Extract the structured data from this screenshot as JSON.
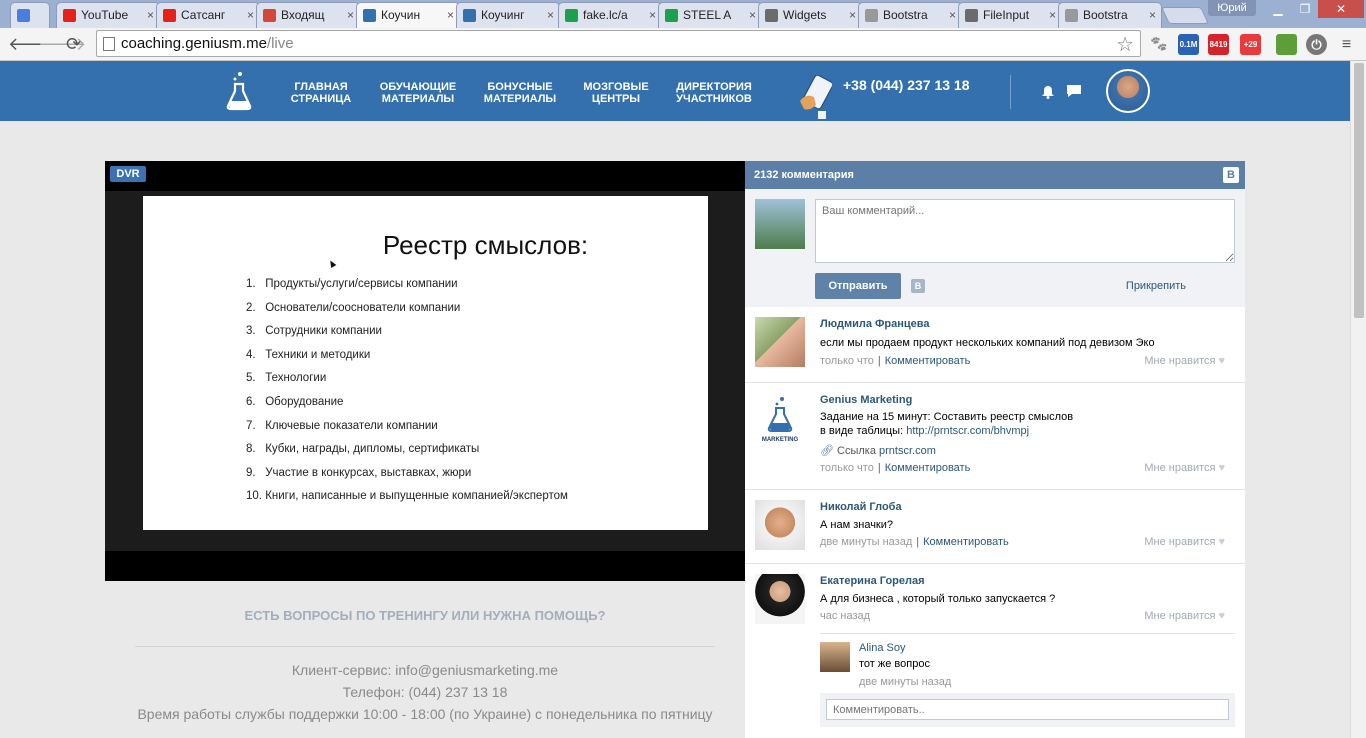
{
  "browser": {
    "tabs": [
      {
        "label": "",
        "icon": "google-icon",
        "color": "#4a7de0"
      },
      {
        "label": "YouTube",
        "icon": "youtube-icon",
        "color": "#e62117"
      },
      {
        "label": "Сатсанг",
        "icon": "youtube-icon",
        "color": "#e62117"
      },
      {
        "label": "Входящ",
        "icon": "gmail-icon",
        "color": "#d44638"
      },
      {
        "label": "Коучин",
        "icon": "flask-icon",
        "color": "#3470ad"
      },
      {
        "label": "Коучинг",
        "icon": "flask-icon",
        "color": "#3470ad"
      },
      {
        "label": "fake.lc/a",
        "icon": "windows-icon",
        "color": "#1ca04b"
      },
      {
        "label": "STEEL A",
        "icon": "windows-icon",
        "color": "#1ca04b"
      },
      {
        "label": "Widgets",
        "icon": "k-icon",
        "color": "#6b6b6b"
      },
      {
        "label": "Bootstra",
        "icon": "document-icon",
        "color": "#999999"
      },
      {
        "label": "FileInput",
        "icon": "k-icon",
        "color": "#6b6b6b"
      },
      {
        "label": "Bootstra",
        "icon": "document-icon",
        "color": "#999999"
      }
    ],
    "user_name": "Юрий",
    "url_host": "coaching.geniusm.me",
    "url_path": "/live",
    "extensions": [
      {
        "name": "paw-icon",
        "label": "",
        "color": "#8e8e8e"
      },
      {
        "name": "counter-icon",
        "label": "0.1M",
        "color": "#2a62b5"
      },
      {
        "name": "mail-counter-icon",
        "label": "8419",
        "color": "#d4232b"
      },
      {
        "name": "weather-icon",
        "label": "+29",
        "color": "#e83a3a"
      },
      {
        "name": "eyedropper-icon",
        "label": "",
        "color": "#5d9e3a"
      },
      {
        "name": "power-icon",
        "label": "",
        "color": "#777777"
      },
      {
        "name": "menu-icon",
        "label": "",
        "color": "#555555"
      }
    ]
  },
  "site": {
    "nav": [
      {
        "line1": "Главная",
        "line2": "страница"
      },
      {
        "line1": "Обучающие",
        "line2": "материалы"
      },
      {
        "line1": "Бонусные",
        "line2": "материалы"
      },
      {
        "line1": "Мозговые",
        "line2": "центры"
      },
      {
        "line1": "Директория",
        "line2": "участников"
      }
    ],
    "phone": "+38 (044) 237 13 18"
  },
  "video": {
    "badge": "DVR",
    "slide_title": "Реестр смыслов:",
    "slide_items": [
      {
        "n": "1.",
        "text": "Продукты/услуги/сервисы компании"
      },
      {
        "n": "2.",
        "text": "Основатели/сооснователи компании"
      },
      {
        "n": "3.",
        "text": "Сотрудники компании"
      },
      {
        "n": "4.",
        "text": "Техники и методики"
      },
      {
        "n": "5.",
        "text": "Технологии"
      },
      {
        "n": "6.",
        "text": "Оборудование"
      },
      {
        "n": "7.",
        "text": "Ключевые показатели компании"
      },
      {
        "n": "8.",
        "text": "Кубки, награды, дипломы, сертификаты"
      },
      {
        "n": "9.",
        "text": "Участие в конкурсах, выставках, жюри"
      },
      {
        "n": "10.",
        "text": "Книги, написанные и выпущенные компанией/экспертом"
      }
    ]
  },
  "help": {
    "title": "ЕСТЬ ВОПРОСЫ ПО ТРЕНИНГУ ИЛИ НУЖНА ПОМОЩЬ?",
    "email_line": "Клиент-сервис: info@geniusmarketing.me",
    "phone_line": "Телефон: (044) 237 13 18",
    "hours_line": "Время работы службы поддержки 10:00 - 18:00 (по Украине) с понедельника по пятницу"
  },
  "comments": {
    "count_label": "2132 комментария",
    "vk_logo": "В",
    "input_placeholder": "Ваш комментарий...",
    "send_label": "Отправить",
    "vk_small": "В",
    "attach_label": "Прикрепить",
    "comment_action": "Комментировать",
    "like_label": "Мне нравится",
    "heart": "♥",
    "items": [
      {
        "name": "Людмила Францева",
        "text": "если мы продаем продукт нескольких компаний под девизом Эко",
        "time": "только что"
      },
      {
        "name": "Genius Marketing",
        "text1": "Задание на 15 минут: Составить реестр смыслов",
        "text2_prefix": "в виде таблицы: ",
        "text2_link": "http://prntscr.com/bhvmpj",
        "link_label_prefix": "Ссылка ",
        "link_label_host": "prntscr.com",
        "avatar_caption": "MARKETING",
        "time": "только что"
      },
      {
        "name": "Николай Глоба",
        "text": "А нам значки?",
        "time": "две минуты назад"
      },
      {
        "name": "Екатерина Горелая",
        "text": "А для бизнеса , который только запускается ?",
        "time": "час назад"
      }
    ],
    "reply": {
      "name": "Alina Soy",
      "text": "тот же вопрос",
      "time": "две минуты назад"
    },
    "reply_placeholder": "Комментировать.."
  }
}
